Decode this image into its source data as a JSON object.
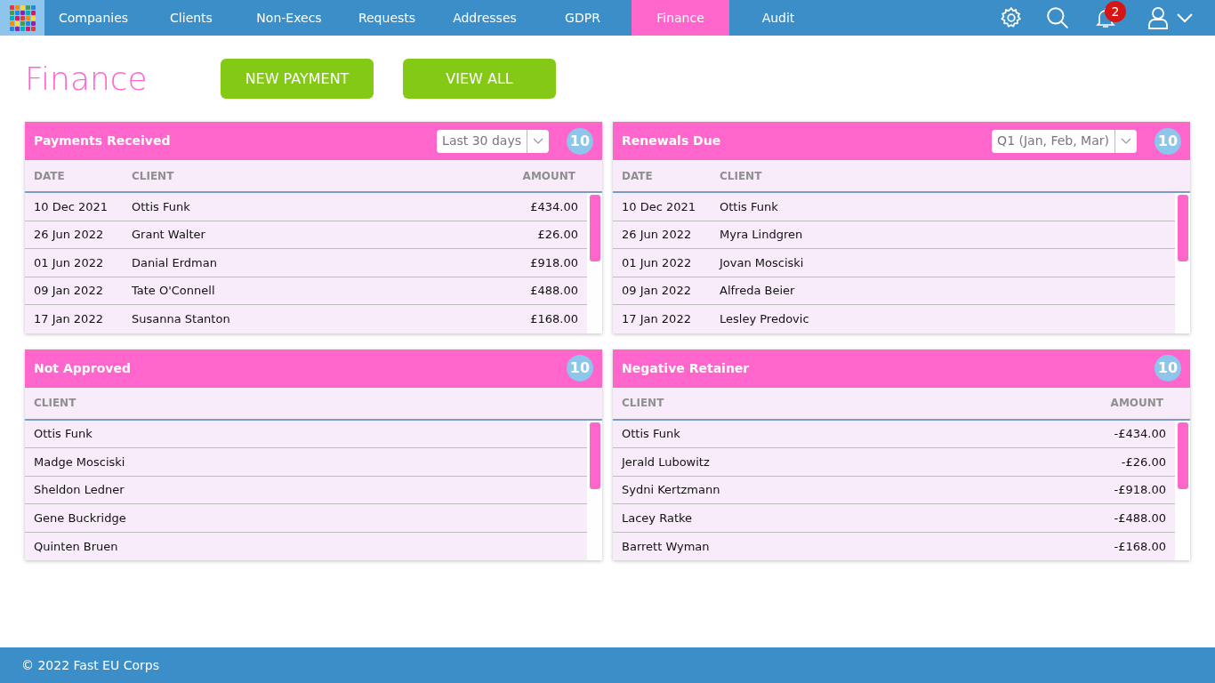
{
  "nav": {
    "tabs": [
      {
        "label": "Companies",
        "selected": false
      },
      {
        "label": "Clients",
        "selected": false
      },
      {
        "label": "Non-Execs",
        "selected": false
      },
      {
        "label": "Requests",
        "selected": false
      },
      {
        "label": "Addresses",
        "selected": false
      },
      {
        "label": "GDPR",
        "selected": false
      },
      {
        "label": "Finance",
        "selected": true
      },
      {
        "label": "Audit",
        "selected": false
      }
    ],
    "notification_count": "2"
  },
  "page": {
    "title": "Finance",
    "buttons": [
      "NEW PAYMENT",
      "VIEW ALL"
    ]
  },
  "panels": [
    {
      "title": "Payments Received",
      "filter": "Last 30 days",
      "count": "10",
      "columns": [
        {
          "label": "DATE",
          "kind": "date"
        },
        {
          "label": "CLIENT",
          "kind": "text"
        },
        {
          "label": "AMOUNT",
          "kind": "amount"
        }
      ],
      "rows": [
        [
          "10 Dec 2021",
          "Ottis Funk",
          "£434.00"
        ],
        [
          "26 Jun 2022",
          "Grant Walter",
          "£26.00"
        ],
        [
          "01 Jun 2022",
          "Danial Erdman",
          "£918.00"
        ],
        [
          "09 Jan 2022",
          "Tate O'Connell",
          "£488.00"
        ],
        [
          "17 Jan 2022",
          "Susanna Stanton",
          "£168.00"
        ]
      ]
    },
    {
      "title": "Renewals Due",
      "filter": "Q1 (Jan, Feb, Mar)",
      "count": "10",
      "columns": [
        {
          "label": "DATE",
          "kind": "date"
        },
        {
          "label": "CLIENT",
          "kind": "text"
        }
      ],
      "rows": [
        [
          "10 Dec 2021",
          "Ottis Funk"
        ],
        [
          "26 Jun 2022",
          "Myra Lindgren"
        ],
        [
          "01 Jun 2022",
          "Jovan Mosciski"
        ],
        [
          "09 Jan 2022",
          "Alfreda Beier"
        ],
        [
          "17 Jan 2022",
          "Lesley Predovic"
        ]
      ]
    },
    {
      "title": "Not Approved",
      "count": "10",
      "columns": [
        {
          "label": "CLIENT",
          "kind": "text"
        }
      ],
      "rows": [
        [
          "Ottis Funk"
        ],
        [
          "Madge Mosciski"
        ],
        [
          "Sheldon Ledner"
        ],
        [
          "Gene Buckridge"
        ],
        [
          "Quinten Bruen"
        ]
      ]
    },
    {
      "title": "Negative Retainer",
      "count": "10",
      "columns": [
        {
          "label": "CLIENT",
          "kind": "text"
        },
        {
          "label": "AMOUNT",
          "kind": "amount"
        }
      ],
      "rows": [
        [
          "Ottis Funk",
          "-£434.00"
        ],
        [
          "Jerald Lubowitz",
          "-£26.00"
        ],
        [
          "Sydni Kertzmann",
          "-£918.00"
        ],
        [
          "Lacey Ratke",
          "-£488.00"
        ],
        [
          "Barrett Wyman",
          "-£168.00"
        ]
      ]
    }
  ],
  "footer": "© 2022 Fast EU Corps"
}
